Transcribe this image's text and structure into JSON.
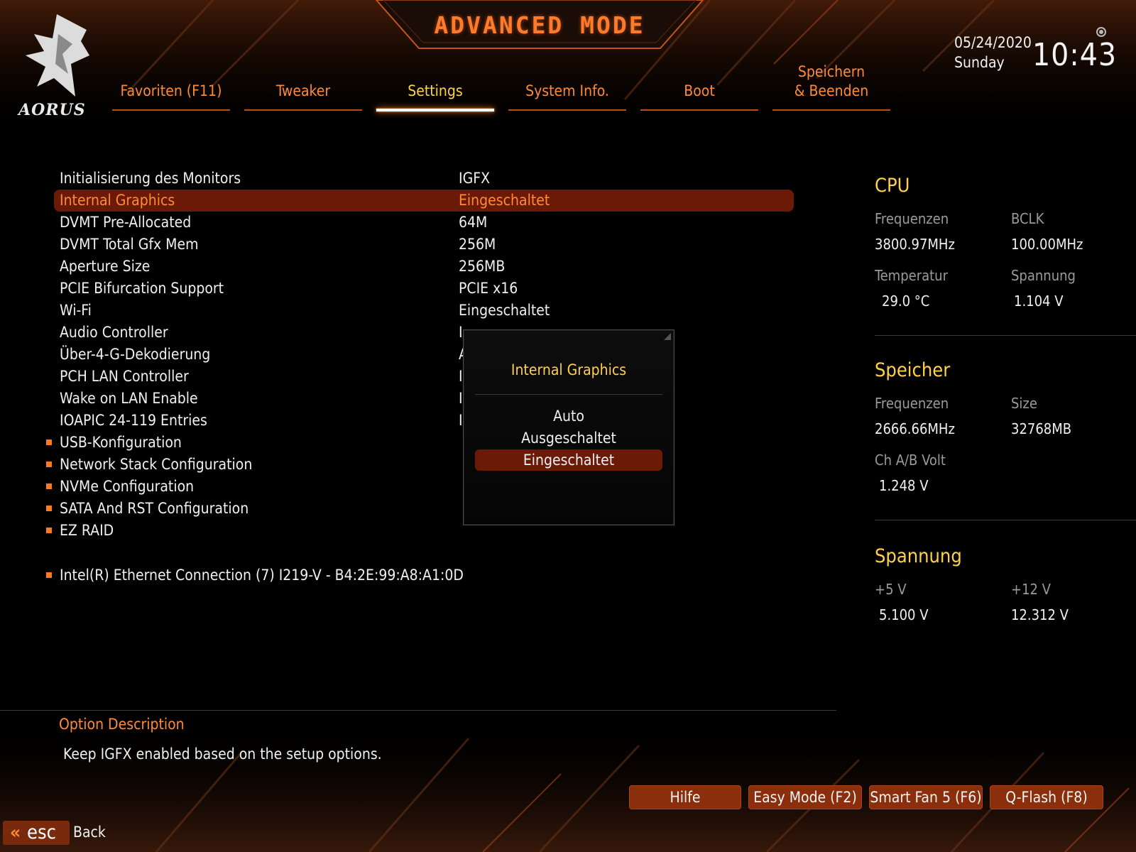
{
  "header": {
    "mode_title": "ADVANCED MODE",
    "brand": "AORUS",
    "date": "05/24/2020",
    "day": "Sunday",
    "time": "10:43"
  },
  "tabs": [
    {
      "label": "Favoriten (F11)"
    },
    {
      "label": "Tweaker"
    },
    {
      "label": "Settings",
      "active": true
    },
    {
      "label": "System Info."
    },
    {
      "label": "Boot"
    },
    {
      "label": "Speichern\n& Beenden"
    }
  ],
  "settings": [
    {
      "name": "Initialisierung des Monitors",
      "value": "IGFX"
    },
    {
      "name": "Internal Graphics",
      "value": "Eingeschaltet",
      "selected": true
    },
    {
      "name": "DVMT Pre-Allocated",
      "value": "64M"
    },
    {
      "name": "DVMT Total Gfx Mem",
      "value": "256M"
    },
    {
      "name": "Aperture Size",
      "value": "256MB"
    },
    {
      "name": "PCIE Bifurcation Support",
      "value": "PCIE x16"
    },
    {
      "name": "Wi-Fi",
      "value": "Eingeschaltet"
    },
    {
      "name": "Audio Controller",
      "value": "I"
    },
    {
      "name": "Über-4-G-Dekodierung",
      "value": "A"
    },
    {
      "name": "PCH LAN Controller",
      "value": "I"
    },
    {
      "name": "Wake on LAN Enable",
      "value": "I"
    },
    {
      "name": "IOAPIC 24-119 Entries",
      "value": "I"
    },
    {
      "name": "USB-Konfiguration",
      "submenu": true
    },
    {
      "name": "Network Stack Configuration",
      "submenu": true
    },
    {
      "name": "NVMe Configuration",
      "submenu": true
    },
    {
      "name": "SATA And RST Configuration",
      "submenu": true
    },
    {
      "name": "EZ RAID",
      "submenu": true
    },
    {
      "name": "Intel(R) Ethernet Connection (7) I219-V - B4:2E:99:A8:A1:0D",
      "submenu": true,
      "gap_before": true
    }
  ],
  "popup": {
    "title": "Internal Graphics",
    "options": [
      "Auto",
      "Ausgeschaltet",
      "Eingeschaltet"
    ],
    "selected_option": "Eingeschaltet"
  },
  "panel": {
    "cpu": {
      "title": "CPU",
      "freq_label": "Frequenzen",
      "freq": "3800.97MHz",
      "bclk_label": "BCLK",
      "bclk": "100.00MHz",
      "temp_label": "Temperatur",
      "temp": "29.0 °C",
      "volt_label": "Spannung",
      "volt": "1.104 V"
    },
    "memory": {
      "title": "Speicher",
      "freq_label": "Frequenzen",
      "freq": "2666.66MHz",
      "size_label": "Size",
      "size": "32768MB",
      "volt_label": "Ch A/B Volt",
      "volt": "1.248 V"
    },
    "voltage": {
      "title": "Spannung",
      "v5_label": "+5 V",
      "v5": "5.100 V",
      "v12_label": "+12 V",
      "v12": "12.312 V"
    }
  },
  "description": {
    "title": "Option Description",
    "text": "Keep IGFX enabled based on the setup options."
  },
  "buttons": {
    "help": "Hilfe",
    "easy_mode": "Easy Mode (F2)",
    "smart_fan": "Smart Fan 5 (F6)",
    "qflash": "Q-Flash (F8)"
  },
  "footer": {
    "esc_key": "esc",
    "back": "Back"
  },
  "colors": {
    "accent_orange": "#ff8a36",
    "title_yellow": "#ffd04a",
    "highlight_bg": "#6b1a07",
    "button_bg": "#8a2e0c"
  }
}
